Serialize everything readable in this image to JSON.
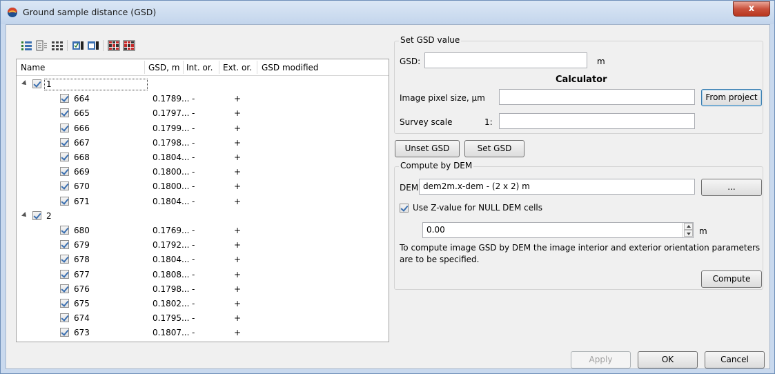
{
  "window": {
    "title": "Ground sample distance (GSD)",
    "close_label": "x"
  },
  "toolbar": {
    "icons": [
      "expand-all-icon",
      "collapse-all-icon",
      "tree-view-icon",
      "check-all-icon",
      "uncheck-all-icon",
      "select-grid-icon",
      "deselect-grid-icon"
    ]
  },
  "tree": {
    "columns": [
      "Name",
      "GSD, m",
      "Int. or.",
      "Ext. or.",
      "GSD modified"
    ],
    "groups": [
      {
        "name": "1",
        "items": [
          {
            "name": "664",
            "gsd": "0.1789...",
            "int": "-",
            "ext": "+"
          },
          {
            "name": "665",
            "gsd": "0.1797...",
            "int": "-",
            "ext": "+"
          },
          {
            "name": "666",
            "gsd": "0.1799...",
            "int": "-",
            "ext": "+"
          },
          {
            "name": "667",
            "gsd": "0.1798...",
            "int": "-",
            "ext": "+"
          },
          {
            "name": "668",
            "gsd": "0.1804...",
            "int": "-",
            "ext": "+"
          },
          {
            "name": "669",
            "gsd": "0.1800...",
            "int": "-",
            "ext": "+"
          },
          {
            "name": "670",
            "gsd": "0.1800...",
            "int": "-",
            "ext": "+"
          },
          {
            "name": "671",
            "gsd": "0.1804...",
            "int": "-",
            "ext": "+"
          }
        ]
      },
      {
        "name": "2",
        "items": [
          {
            "name": "680",
            "gsd": "0.1769...",
            "int": "-",
            "ext": "+"
          },
          {
            "name": "679",
            "gsd": "0.1792...",
            "int": "-",
            "ext": "+"
          },
          {
            "name": "678",
            "gsd": "0.1804...",
            "int": "-",
            "ext": "+"
          },
          {
            "name": "677",
            "gsd": "0.1808...",
            "int": "-",
            "ext": "+"
          },
          {
            "name": "676",
            "gsd": "0.1798...",
            "int": "-",
            "ext": "+"
          },
          {
            "name": "675",
            "gsd": "0.1802...",
            "int": "-",
            "ext": "+"
          },
          {
            "name": "674",
            "gsd": "0.1795...",
            "int": "-",
            "ext": "+"
          },
          {
            "name": "673",
            "gsd": "0.1807...",
            "int": "-",
            "ext": "+"
          }
        ]
      }
    ]
  },
  "set_gsd": {
    "group_title": "Set GSD value",
    "gsd_label": "GSD:",
    "gsd_value": "",
    "gsd_unit": "m",
    "calculator_title": "Calculator",
    "pixel_size_label": "Image pixel size, μm",
    "pixel_size_value": "",
    "from_project_label": "From project",
    "survey_scale_label": "Survey scale",
    "scale_prefix": "1:",
    "survey_scale_value": ""
  },
  "actions": {
    "unset_label": "Unset GSD",
    "set_label": "Set GSD"
  },
  "dem": {
    "group_title": "Compute by DEM",
    "dem_label": "DEM",
    "dem_value": "dem2m.x-dem - (2 x 2) m",
    "browse_label": "...",
    "use_z_label": "Use Z-value for NULL DEM cells",
    "use_z_checked": true,
    "z_value": "0.00",
    "z_unit": "m",
    "description": "To compute image GSD by DEM the image interior and exterior orientation parameters are to be specified.",
    "compute_label": "Compute"
  },
  "footer": {
    "apply_label": "Apply",
    "ok_label": "OK",
    "cancel_label": "Cancel"
  },
  "colors": {
    "title_bar": "#c3d5ec",
    "close_button": "#c9513c",
    "checkbox_mark": "#3a6fb0",
    "default_button_border": "#3c7fb1"
  }
}
